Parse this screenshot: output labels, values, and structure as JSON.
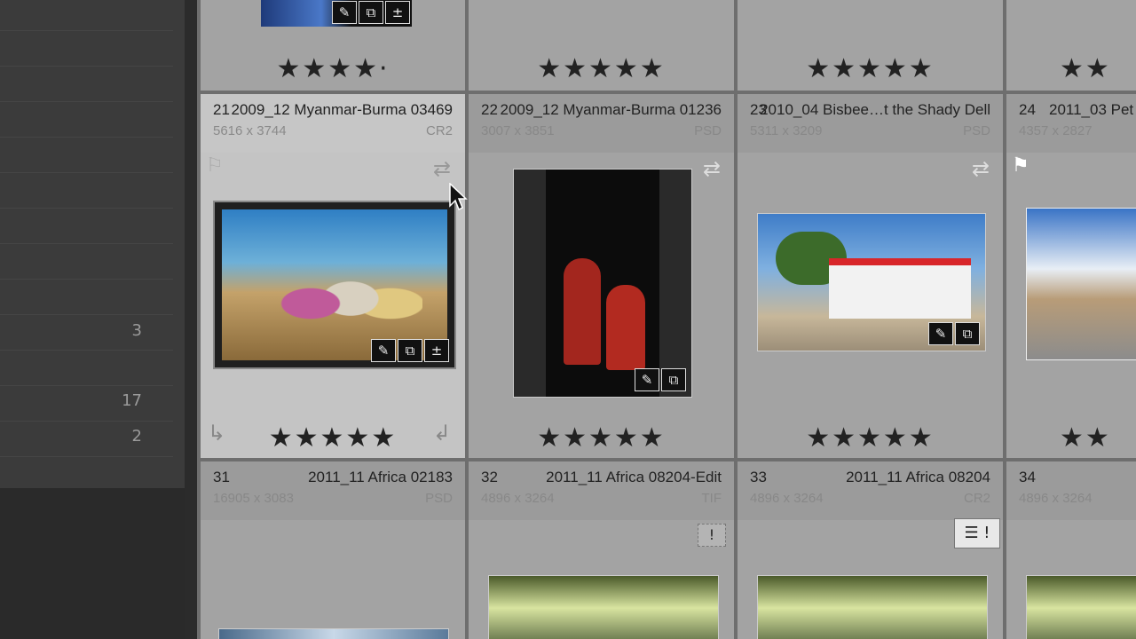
{
  "left_panel": {
    "counts": [
      "3",
      "17",
      "2"
    ]
  },
  "cells": {
    "r0c0": {
      "stars": "★★★★·"
    },
    "r0c1": {
      "stars": "★★★★★"
    },
    "r0c2": {
      "stars": "★★★★★"
    },
    "r0c3": {
      "stars": "★★"
    },
    "c21": {
      "num": "21",
      "name": "2009_12 Myanmar-Burma 03469",
      "dims": "5616 x 3744",
      "ext": "CR2",
      "stars": "★★★★★"
    },
    "c22": {
      "num": "22",
      "name": "2009_12 Myanmar-Burma 01236",
      "dims": "3007 x 3851",
      "ext": "PSD",
      "stars": "★★★★★"
    },
    "c23": {
      "num": "23",
      "name": "2010_04 Bisbee…t the Shady Dell",
      "dims": "5311 x 3209",
      "ext": "PSD",
      "stars": "★★★★★"
    },
    "c24": {
      "num": "24",
      "name": "2011_03 Pet",
      "dims": "4357 x 2827",
      "ext": "",
      "stars": "★★"
    },
    "c31": {
      "num": "31",
      "name": "2011_11 Africa 02183",
      "dims": "16905 x 3083",
      "ext": "PSD"
    },
    "c32": {
      "num": "32",
      "name": "2011_11 Africa 08204-Edit",
      "dims": "4896 x 3264",
      "ext": "TIF"
    },
    "c33": {
      "num": "33",
      "name": "2011_11 Africa 08204",
      "dims": "4896 x 3264",
      "ext": "CR2"
    },
    "c34": {
      "num": "34",
      "name": "",
      "dims": "4896 x 3264",
      "ext": ""
    }
  },
  "icons": {
    "keyword": "tag-icon",
    "crop": "crop-icon",
    "develop": "develop-adjust-icon",
    "flag": "flag-icon",
    "rotate": "rotate-icon",
    "warning": "warning-icon",
    "stack": "stack-icon"
  }
}
